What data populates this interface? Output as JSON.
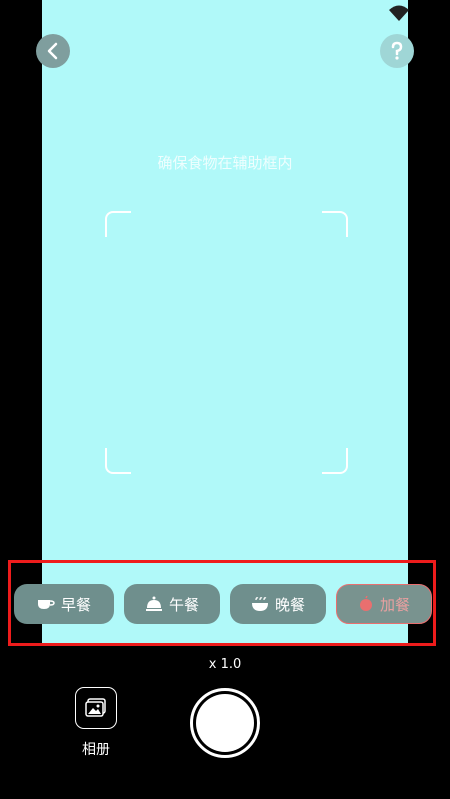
{
  "camera": {
    "hint": "确保食物在辅助框内",
    "zoom_label": "x 1.0"
  },
  "icons": {
    "back": "chevron-left-icon",
    "help": "question-mark-icon",
    "status": "wifi-icon",
    "album": "image-gallery-icon"
  },
  "meals": [
    {
      "label": "早餐",
      "icon": "coffee-cup-icon"
    },
    {
      "label": "午餐",
      "icon": "service-bell-icon"
    },
    {
      "label": "晚餐",
      "icon": "rice-bowl-icon"
    },
    {
      "label": "加餐",
      "icon": "apple-icon"
    }
  ],
  "album": {
    "label": "相册"
  },
  "colors": {
    "viewfinder": "#b0f9f9",
    "meal_button": "#6f8f8d",
    "snack_border": "#e96f6f",
    "highlight": "#ee1c1c"
  }
}
